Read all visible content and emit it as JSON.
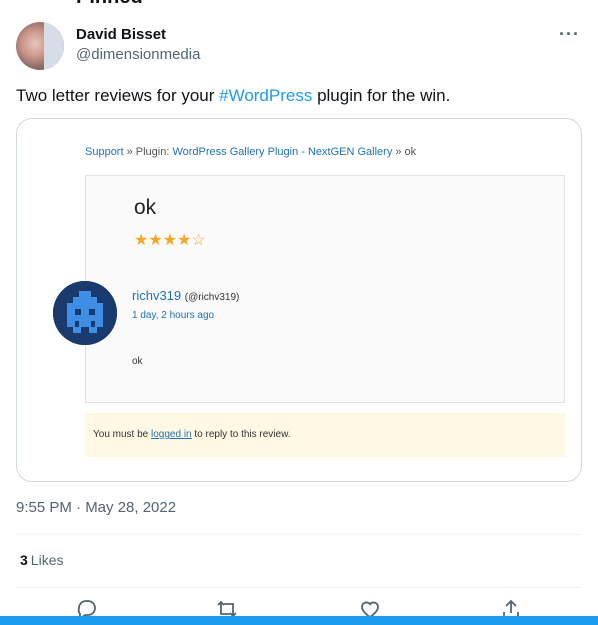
{
  "tweet": {
    "author_name": "David Bisset",
    "author_handle": "@dimensionmedia",
    "more_label": "···",
    "text_before": "Two letter reviews for your ",
    "hashtag": "#WordPress",
    "text_after": " plugin for the win.",
    "timestamp": "9:55 PM · May 28, 2022",
    "likes_count": "3",
    "likes_label": "Likes"
  },
  "embedded_review": {
    "breadcrumb": {
      "support": "Support",
      "sep1": " » Plugin: ",
      "plugin": "WordPress Gallery Plugin - NextGEN Gallery",
      "sep2": " » ok"
    },
    "title": "ok",
    "rating": 4,
    "rating_max": 5,
    "stars_filled": "★★★★",
    "stars_empty": "☆",
    "reviewer_name": "richv319",
    "reviewer_handle": "(@richv319)",
    "reviewer_date": "1 day, 2 hours ago",
    "body": "ok",
    "login_before": "You must be ",
    "login_link": "logged in",
    "login_after": " to reply to this review."
  },
  "actions": {
    "icons": [
      "reply-icon",
      "retweet-icon",
      "like-icon",
      "share-icon"
    ]
  },
  "colors": {
    "accent": "#1d9bf0",
    "link": "#2271b1",
    "star": "#f5a623",
    "notice_bg": "#fff8e5"
  }
}
